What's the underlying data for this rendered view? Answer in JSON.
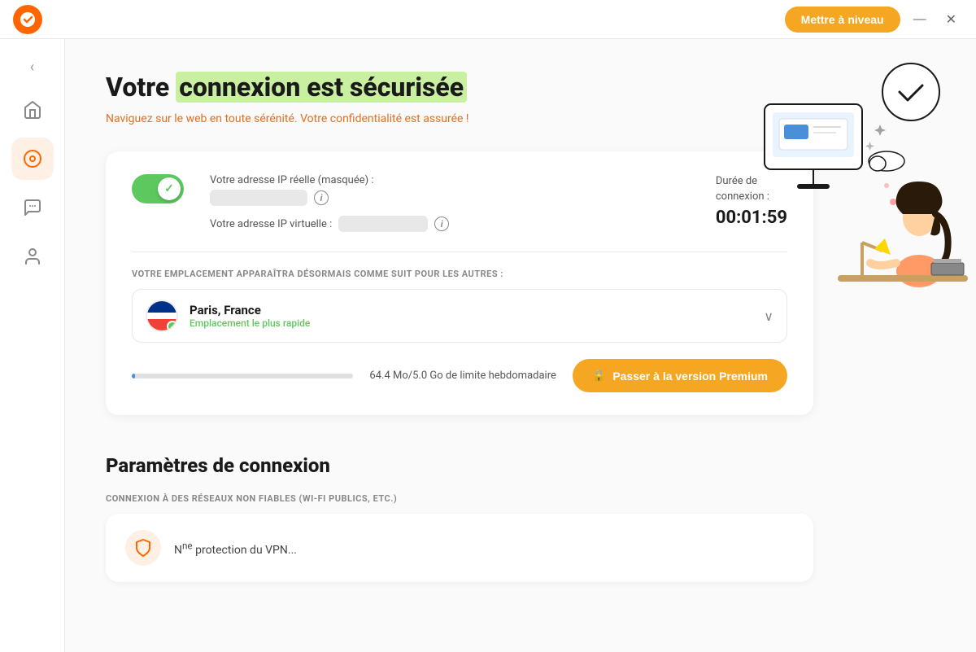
{
  "titlebar": {
    "upgrade_label": "Mettre à niveau",
    "minimize_label": "—",
    "close_label": "✕"
  },
  "sidebar": {
    "back_label": "‹",
    "items": [
      {
        "id": "home",
        "icon": "⌂",
        "active": false
      },
      {
        "id": "vpn",
        "icon": "◎",
        "active": true
      },
      {
        "id": "chat",
        "icon": "⊙",
        "active": false
      },
      {
        "id": "user",
        "icon": "◯",
        "active": false
      }
    ]
  },
  "header": {
    "title_before": "Votre ",
    "title_highlight": "connexion est sécurisée",
    "subtitle": "Naviguez sur le web en toute sérénité. Votre confidentialité est assurée !"
  },
  "connection": {
    "ip_real_label": "Votre adresse IP réelle (masquée) :",
    "ip_virtual_label": "Votre adresse IP virtuelle :",
    "duration_label": "Durée de\nconnexion :",
    "duration_value": "00:01:59",
    "location_section_label": "VOTRE EMPLACEMENT APPARAÎTRA DÉSORMAIS COMME SUIT POUR LES AUTRES :",
    "location_name": "Paris, France",
    "location_sub": "Emplacement le plus rapide",
    "progress_text": "64.4 Mo/5.0 Go de limite hebdomadaire",
    "premium_label": "Passer à la version Premium"
  },
  "settings": {
    "title": "Paramètres de connexion",
    "section_label": "CONNEXION À DES RÉSEAUX NON FIABLES (WI-FI PUBLICS, ETC.)",
    "card_text": "Nne protection du VPN..."
  }
}
